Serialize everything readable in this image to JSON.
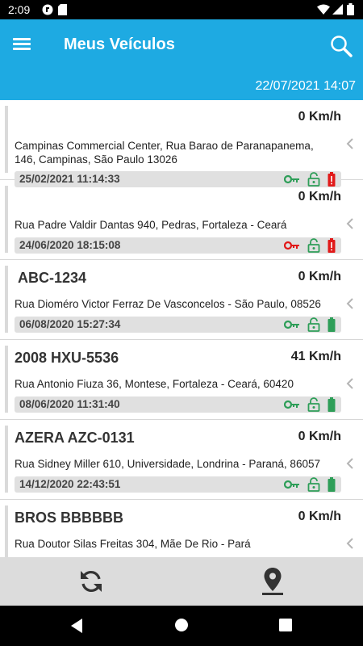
{
  "status_bar": {
    "time": "2:09"
  },
  "app_bar": {
    "title": "Meus Veículos"
  },
  "date_bar": {
    "datetime": "22/07/2021 14:07"
  },
  "colors": {
    "primary": "#1eaae2",
    "ok_green": "#2e9e58",
    "alert_red": "#e11919",
    "timestamp_bar": "#e0e0e0",
    "bottom_bar": "#dcdcdc"
  },
  "vehicles": [
    {
      "name": "",
      "speed": "0 Km/h",
      "address": "Campinas Commercial Center, Rua Barao de Paranapanema, 146, Campinas, São Paulo 13026",
      "timestamp": "25/02/2021 11:14:33",
      "ignition": "on",
      "lock": "unlocked",
      "battery": "low"
    },
    {
      "name": "",
      "speed": "0 Km/h",
      "address": "Rua Padre Valdir Dantas 940, Pedras, Fortaleza - Ceará",
      "timestamp": "24/06/2020 18:15:08",
      "ignition": "off",
      "lock": "unlocked",
      "battery": "low"
    },
    {
      "name": "ABC-1234",
      "speed": "0 Km/h",
      "address": "Rua Dioméro Victor Ferraz De Vasconcelos - São Paulo, 08526",
      "timestamp": "06/08/2020 15:27:34",
      "ignition": "on",
      "lock": "unlocked",
      "battery": "ok"
    },
    {
      "name": "2008 HXU-5536",
      "speed": "41 Km/h",
      "address": "Rua Antonio Fiuza 36, Montese, Fortaleza - Ceará, 60420",
      "timestamp": "08/06/2020 11:31:40",
      "ignition": "on",
      "lock": "unlocked",
      "battery": "ok"
    },
    {
      "name": "AZERA AZC-0131",
      "speed": "0 Km/h",
      "address": "Rua Sidney Miller 610, Universidade, Londrina - Paraná, 86057",
      "timestamp": "14/12/2020 22:43:51",
      "ignition": "on",
      "lock": "unlocked",
      "battery": "ok"
    },
    {
      "name": "BROS BBBBBB",
      "speed": "0 Km/h",
      "address": "Rua Doutor Silas Freitas 304, Mãe De Rio - Pará",
      "timestamp": "",
      "ignition": "",
      "lock": "",
      "battery": ""
    }
  ],
  "icons": {
    "menu": "hamburger-menu-icon",
    "search": "search-icon",
    "ignition": "key-icon",
    "lock": "unlocked-padlock-icon",
    "battery": "battery-icon",
    "expand": "chevron-left-icon",
    "refresh": "refresh-icon",
    "map": "map-pin-icon"
  }
}
